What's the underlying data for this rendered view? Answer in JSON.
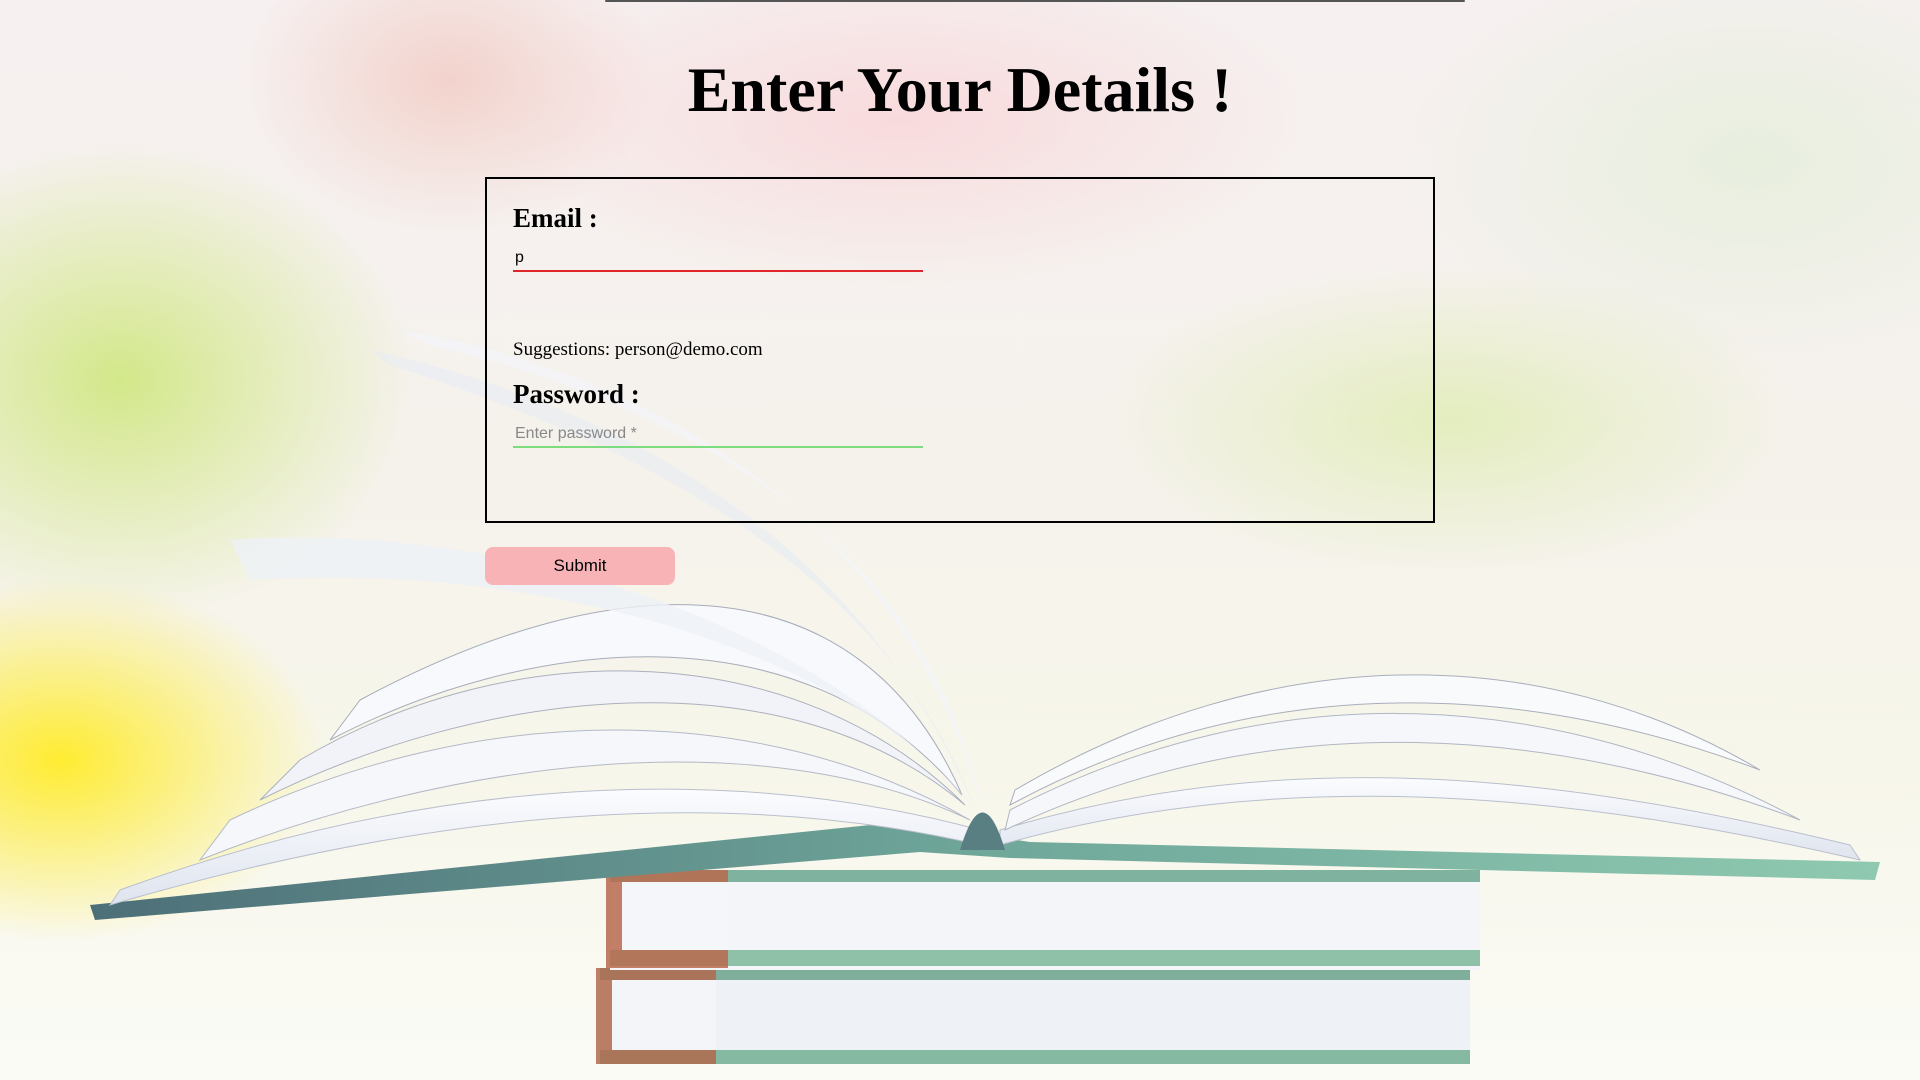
{
  "page": {
    "title": "Enter Your Details !"
  },
  "form": {
    "email_label": "Email :",
    "email_value": "p",
    "suggestions": "Suggestions: person@demo.com",
    "password_label": "Password :",
    "password_placeholder": "Enter password *",
    "submit_label": "Submit"
  },
  "colors": {
    "email_underline": "#e0262b",
    "password_underline": "#7ddc7d",
    "submit_background": "#f8b3b7"
  },
  "background": {
    "image": "open-book-on-stack-of-books"
  }
}
